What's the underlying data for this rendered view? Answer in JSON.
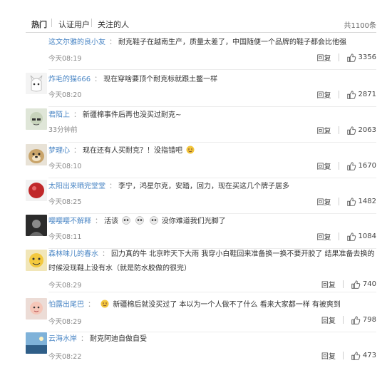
{
  "tabs": {
    "items": [
      "热门",
      "认证用户",
      "关注的人"
    ],
    "total": "共1100条"
  },
  "actions": {
    "reply_label": "回复"
  },
  "comments": [
    {
      "user": "这文尔雅的良小友",
      "text": "耐克鞋子在越南生产，质量太差了，中国随便一个品牌的鞋子都会比他强",
      "time": "今天08:19",
      "likes": "3356"
    },
    {
      "user": "炸毛的猫666",
      "text": "现在穿啥要顶个耐克标就跟土鳖一样",
      "time": "今天08:20",
      "likes": "2871"
    },
    {
      "user": "君陌上",
      "text": "新疆棉事件后再也没买过耐克~",
      "time": "33分钟前",
      "likes": "2063"
    },
    {
      "user": "梦理心",
      "text": "现在还有人买耐克？！没指错吧",
      "time": "今天08:10",
      "likes": "1670"
    },
    {
      "user": "太阳出来晒完堂堂",
      "text": "李宁，鸿星尔克，安踏，回力，现在买这几个牌子居多",
      "time": "今天08:25",
      "likes": "1482"
    },
    {
      "user": "嘤嘤嘤不解释",
      "text": "活该",
      "text2": "没你难道我们光脚了",
      "time": "今天08:11",
      "likes": "1084"
    },
    {
      "user": "森林味儿的春水",
      "text": "回力真的牛 北京昨天下大雨 我穿小白鞋回来准备换一换不要开胶了 结果准备去换的时候没现鞋上没有水（就是防水胶做的很完）",
      "time": "今天08:29",
      "likes": "740"
    },
    {
      "user": "怕露出尾巴",
      "text": "新疆棉后就没买过了 本以为一个人做不了什么 看来大家都一样 有被爽到",
      "time": "今天08:29",
      "likes": "798"
    },
    {
      "user": "云海水岸",
      "text": "耐克阿迪自做自受",
      "time": "今天08:22",
      "likes": "473"
    }
  ],
  "colors": {
    "username": "#4a86c5",
    "meta": "#888888",
    "text": "#333333"
  },
  "icons": {
    "like": "thumb-up-icon"
  }
}
